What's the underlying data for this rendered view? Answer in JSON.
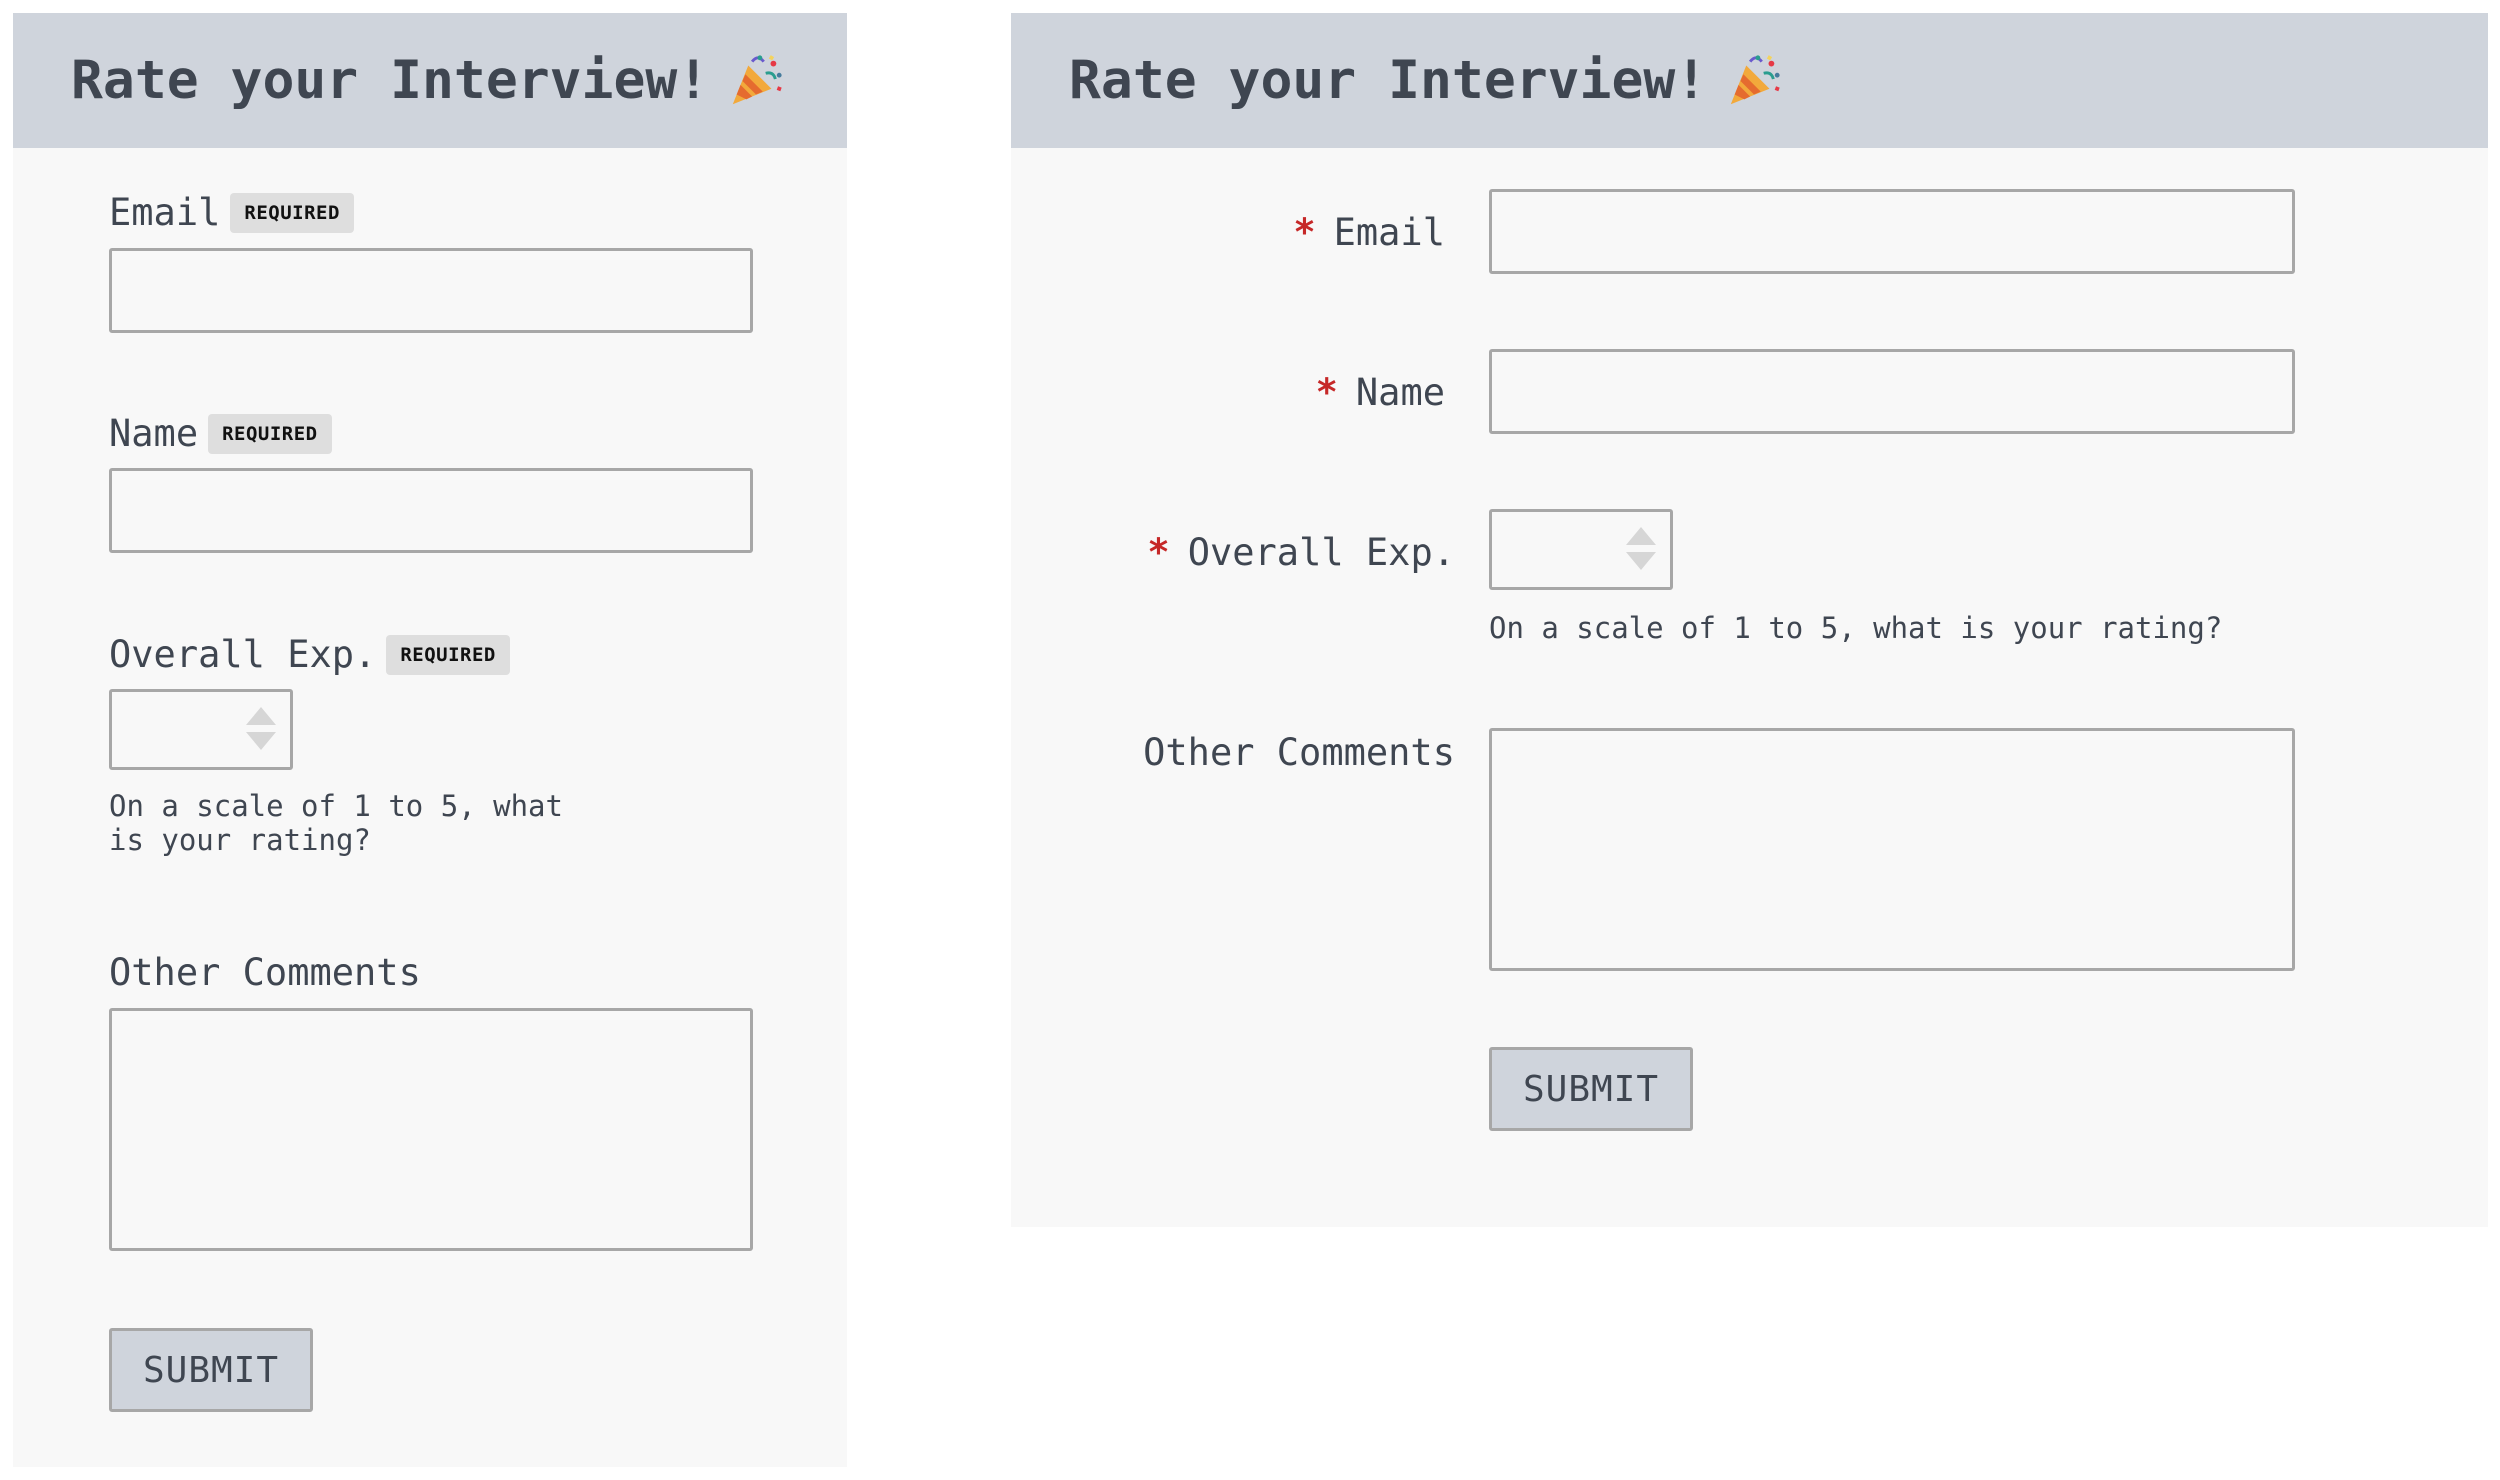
{
  "forms": {
    "stacked": {
      "title": "Rate your Interview!",
      "required_badge": "REQUIRED",
      "email_label": "Email",
      "name_label": "Name",
      "overall_label": "Overall Exp.",
      "overall_hint": "On a scale of 1 to 5, what is your rating?",
      "comments_label": "Other Comments",
      "submit_label": "SUBMIT"
    },
    "inline": {
      "title": "Rate your Interview!",
      "required_marker": "*",
      "email_label": "Email",
      "name_label": "Name",
      "overall_label": "Overall Exp.",
      "overall_hint": "On a scale of 1 to 5, what is your rating?",
      "comments_label": "Other Comments",
      "submit_label": "SUBMIT"
    }
  },
  "icons": {
    "title_icon": "party-popper-icon",
    "spinner_icon": "number-spinner-icon"
  },
  "colors": {
    "header_bg": "#cfd4dc",
    "panel_bg": "#f8f8f8",
    "text": "#3f4651",
    "required_star": "#c62828",
    "badge_bg": "#dedede",
    "input_border": "#a7a7a7"
  }
}
